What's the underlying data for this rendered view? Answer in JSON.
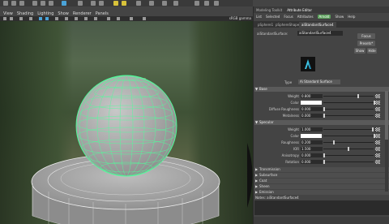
{
  "menubar": {
    "items": [
      "View",
      "Shading",
      "Lighting",
      "Show",
      "Renderer",
      "Panels"
    ]
  },
  "viewport": {
    "label": "sRGB gamma"
  },
  "panel_tabs": [
    "Modeling Toolkit",
    "Attribute Editor"
  ],
  "panel_menu": [
    "List",
    "Selected",
    "Focus",
    "Attributes"
  ],
  "panel_mode": "Arnold",
  "panel_menu_tail": [
    "Show",
    "Help"
  ],
  "node_tabs": [
    "pSphere1",
    "pSphereShape1",
    "aiStandardSurface4"
  ],
  "node": {
    "label": "aiStandardSurface:",
    "name": "aiStandardSurface4",
    "focus_label": "Focus",
    "presets_label": "Presets*",
    "show_label": "Show",
    "hide_label": "Hide"
  },
  "type": {
    "label": "Type",
    "value": "Ai Standard Surface"
  },
  "base": {
    "title": "Base",
    "weight_label": "Weight",
    "weight": "0.800",
    "color_label": "Color",
    "diffuse_label": "Diffuse Roughness",
    "diffuse": "0.000",
    "metalness_label": "Metalness",
    "metalness": "0.000"
  },
  "specular": {
    "title": "Specular",
    "weight_label": "Weight",
    "weight": "1.000",
    "color_label": "Color",
    "roughness_label": "Roughness",
    "roughness": "0.200",
    "ior_label": "IOR",
    "ior": "1.500",
    "anisotropy_label": "Anisotropy",
    "anisotropy": "0.000",
    "rotation_label": "Rotation",
    "rotation": "0.000"
  },
  "collapsed_sections": [
    "Transmission",
    "Subsurface",
    "Coat",
    "Sheen",
    "Emission"
  ],
  "notes_label": "Notes:  aiStandardSurface4",
  "colors": {
    "selection_wire": "#4dff9a",
    "mode_green": "#5aa05a",
    "accent_blue": "#4aa3d8"
  }
}
